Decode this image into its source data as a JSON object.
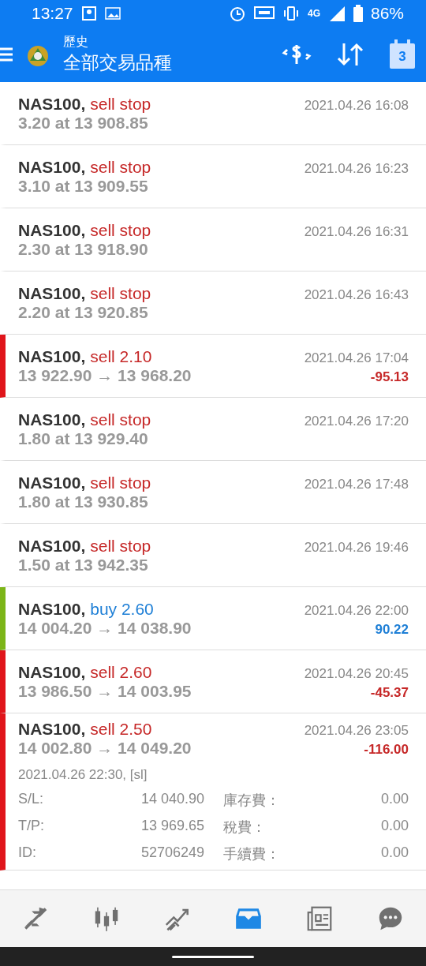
{
  "status_bar": {
    "time": "13:27",
    "network": "4G",
    "battery": "86%"
  },
  "header": {
    "subtitle": "歷史",
    "title": "全部交易品種",
    "calendar_day": "3"
  },
  "rows": [
    {
      "kind": "order",
      "symbol": "NAS100,",
      "action": "sell stop",
      "buy": false,
      "line2": "3.20 at 13 908.85",
      "time": "2021.04.26 16:08"
    },
    {
      "kind": "order",
      "symbol": "NAS100,",
      "action": "sell stop",
      "buy": false,
      "line2": "3.10 at 13 909.55",
      "time": "2021.04.26 16:23"
    },
    {
      "kind": "order",
      "symbol": "NAS100,",
      "action": "sell stop",
      "buy": false,
      "line2": "2.30 at 13 918.90",
      "time": "2021.04.26 16:31"
    },
    {
      "kind": "order",
      "symbol": "NAS100,",
      "action": "sell stop",
      "buy": false,
      "line2": "2.20 at 13 920.85",
      "time": "2021.04.26 16:43"
    },
    {
      "kind": "deal",
      "symbol": "NAS100,",
      "action": "sell 2.10",
      "buy": false,
      "line2": "13 922.90 → 13 968.20",
      "time": "2021.04.26 17:04",
      "profit": "-95.13",
      "profit_positive": false
    },
    {
      "kind": "order",
      "symbol": "NAS100,",
      "action": "sell stop",
      "buy": false,
      "line2": "1.80 at 13 929.40",
      "time": "2021.04.26 17:20"
    },
    {
      "kind": "order",
      "symbol": "NAS100,",
      "action": "sell stop",
      "buy": false,
      "line2": "1.80 at 13 930.85",
      "time": "2021.04.26 17:48"
    },
    {
      "kind": "order",
      "symbol": "NAS100,",
      "action": "sell stop",
      "buy": false,
      "line2": "1.50 at 13 942.35",
      "time": "2021.04.26 19:46"
    },
    {
      "kind": "deal",
      "symbol": "NAS100,",
      "action": "buy 2.60",
      "buy": true,
      "line2": "14 004.20 → 14 038.90",
      "time": "2021.04.26 22:00",
      "profit": "90.22",
      "profit_positive": true
    },
    {
      "kind": "deal",
      "symbol": "NAS100,",
      "action": "sell 2.60",
      "buy": false,
      "line2": "13 986.50 → 14 003.95",
      "time": "2021.04.26 20:45",
      "profit": "-45.37",
      "profit_positive": false
    },
    {
      "kind": "deal",
      "symbol": "NAS100,",
      "action": "sell 2.50",
      "buy": false,
      "line2": "14 002.80 → 14 049.20",
      "time": "2021.04.26 23:05",
      "profit": "-116.00",
      "profit_positive": false,
      "details": {
        "info": "2021.04.26 22:30, [sl]",
        "pairs": [
          {
            "label": "S/L:",
            "value": "14 040.90",
            "label_2": "庫存費：",
            "value_2": "0.00"
          },
          {
            "label": "T/P:",
            "value": "13 969.65",
            "label_2": "稅費：",
            "value_2": "0.00"
          },
          {
            "label": "ID:",
            "value": "52706249",
            "label_2": "手續費：",
            "value_2": "0.00"
          }
        ]
      }
    }
  ],
  "bottom_nav": [
    {
      "kind": "trade",
      "selected": false
    },
    {
      "kind": "quotes",
      "selected": false
    },
    {
      "kind": "chart",
      "selected": false
    },
    {
      "kind": "history",
      "selected": true
    },
    {
      "kind": "news",
      "selected": false
    },
    {
      "kind": "chat",
      "selected": false
    }
  ]
}
